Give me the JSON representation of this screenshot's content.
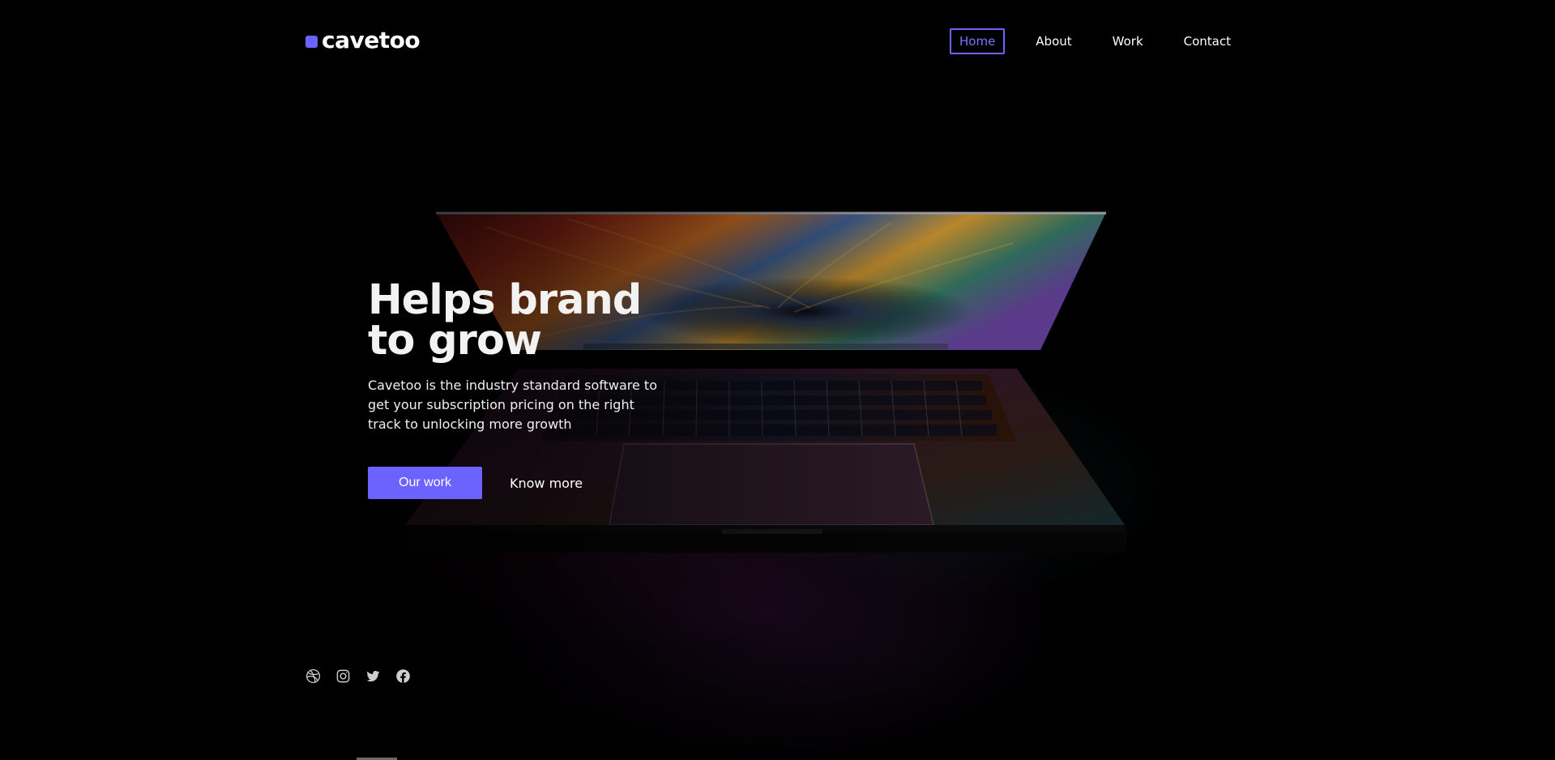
{
  "brand": {
    "name": "cavetoo",
    "accent_color": "#6c63ff"
  },
  "nav": {
    "items": [
      {
        "label": "Home",
        "active": true
      },
      {
        "label": "About",
        "active": false
      },
      {
        "label": "Work",
        "active": false
      },
      {
        "label": "Contact",
        "active": false
      }
    ]
  },
  "hero": {
    "title": "Helps brand\nto grow",
    "description": "Cavetoo is the industry standard software to get your subscription pricing on the right track to unlocking more growth",
    "primary_button": "Our work",
    "secondary_link": "Know more"
  },
  "socials": [
    {
      "icon": "dribbble-icon"
    },
    {
      "icon": "instagram-icon"
    },
    {
      "icon": "twitter-icon"
    },
    {
      "icon": "facebook-icon"
    }
  ]
}
